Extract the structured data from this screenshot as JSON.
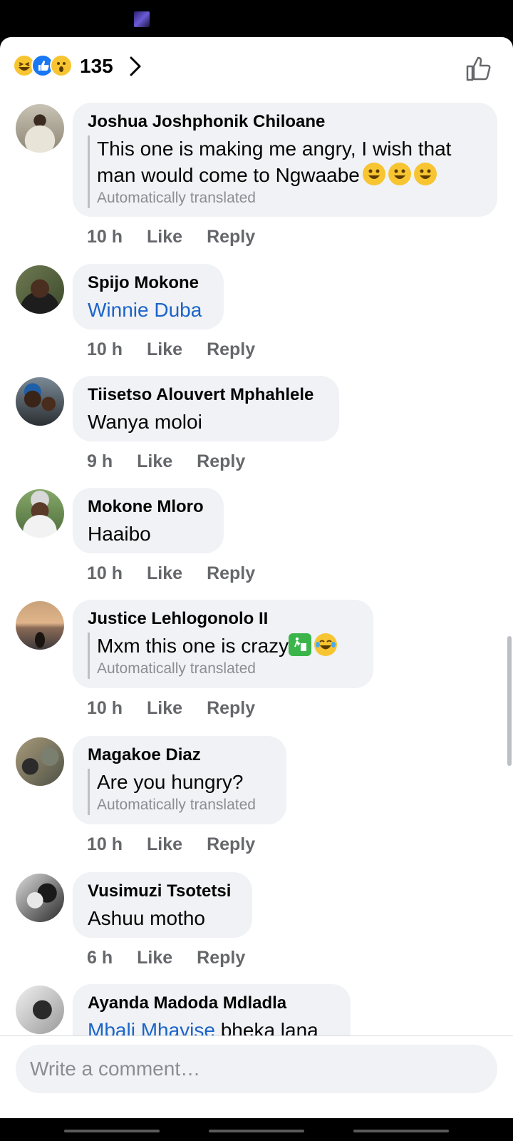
{
  "header": {
    "reaction_count": "135",
    "reactions": [
      "haha-icon",
      "like-icon",
      "wow-icon"
    ]
  },
  "comments": [
    {
      "author": "Joshua Joshphonik Chiloane",
      "text": "This one is making me angry, I wish that man would come to Ngwaabe",
      "emojis": [
        "grinning-emoji",
        "grinning-emoji",
        "grinning-emoji"
      ],
      "note": "Automatically translated",
      "time": "10 h",
      "like": "Like",
      "reply": "Reply"
    },
    {
      "author": "Spijo Mokone",
      "mention": "Winnie Duba",
      "time": "10 h",
      "like": "Like",
      "reply": "Reply"
    },
    {
      "author": "Tiisetso Alouvert Mphahlele",
      "text": "Wanya moloi",
      "time": "9 h",
      "like": "Like",
      "reply": "Reply"
    },
    {
      "author": "Mokone Mloro",
      "text": "Haaibo",
      "time": "10 h",
      "like": "Like",
      "reply": "Reply"
    },
    {
      "author": "Justice Lehlogonolo II",
      "text": "Mxm this one is crazy",
      "emojis": [
        "litter-bin-emoji",
        "tears-of-joy-emoji"
      ],
      "note": "Automatically translated",
      "time": "10 h",
      "like": "Like",
      "reply": "Reply"
    },
    {
      "author": "Magakoe Diaz",
      "text": "Are you hungry?",
      "note": "Automatically translated",
      "time": "10 h",
      "like": "Like",
      "reply": "Reply"
    },
    {
      "author": "Vusimuzi Tsotetsi",
      "text": "Ashuu motho",
      "time": "6 h",
      "like": "Like",
      "reply": "Reply"
    },
    {
      "author": "Ayanda Madoda Mdladla",
      "mention": "Mbali Mhayise",
      "text": " bheka lana"
    }
  ],
  "composer": {
    "placeholder": "Write a comment…"
  },
  "colors": {
    "bubble": "#f0f2f5",
    "mention": "#1b64c8",
    "meta": "#65676b",
    "like_blue": "#1877f2",
    "emoji_yellow": "#f7c531"
  }
}
